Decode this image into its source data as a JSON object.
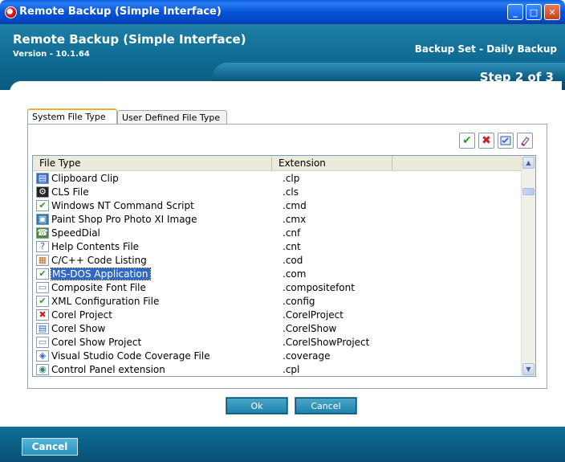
{
  "window": {
    "title": "Remote Backup (Simple Interface)",
    "controls": {
      "minimize": "_",
      "maximize": "□",
      "close": "✕"
    }
  },
  "header": {
    "app_name": "Remote Backup (Simple Interface)",
    "version": "Version - 10.1.64",
    "backup_set": "Backup Set - Daily Backup",
    "step": "Step 2 of 3"
  },
  "tabs": [
    {
      "label": "System File Type",
      "active": true
    },
    {
      "label": "User Defined File Type",
      "active": false
    }
  ],
  "toolbar": {
    "select_all_icon": "✔",
    "deselect_all_icon": "✖",
    "select_icon": "select-icon",
    "clear_icon": "eraser-icon"
  },
  "list": {
    "columns": [
      "File Type",
      "Extension"
    ],
    "rows": [
      {
        "file_type": "Clipboard Clip",
        "extension": ".clp",
        "icon": "clipboard-icon"
      },
      {
        "file_type": "CLS File",
        "extension": ".cls",
        "icon": "gear-icon"
      },
      {
        "file_type": "Windows NT Command Script",
        "extension": ".cmd",
        "icon": "check-icon"
      },
      {
        "file_type": "Paint Shop Pro Photo XI Image",
        "extension": ".cmx",
        "icon": "image-icon"
      },
      {
        "file_type": "SpeedDial",
        "extension": ".cnf",
        "icon": "speeddial-icon"
      },
      {
        "file_type": "Help Contents File",
        "extension": ".cnt",
        "icon": "help-icon"
      },
      {
        "file_type": "C/C++ Code Listing",
        "extension": ".cod",
        "icon": "code-icon"
      },
      {
        "file_type": "MS-DOS Application",
        "extension": ".com",
        "icon": "check-icon",
        "selected": true
      },
      {
        "file_type": "Composite Font File",
        "extension": ".compositefont",
        "icon": "file-icon"
      },
      {
        "file_type": "XML Configuration File",
        "extension": ".config",
        "icon": "xml-icon"
      },
      {
        "file_type": "Corel Project",
        "extension": ".CorelProject",
        "icon": "x-icon"
      },
      {
        "file_type": "Corel Show",
        "extension": ".CorelShow",
        "icon": "document-icon"
      },
      {
        "file_type": "Corel Show Project",
        "extension": ".CorelShowProject",
        "icon": "file-icon"
      },
      {
        "file_type": "Visual Studio Code Coverage File",
        "extension": ".coverage",
        "icon": "coverage-icon"
      },
      {
        "file_type": "Control Panel extension",
        "extension": ".cpl",
        "icon": "control-panel-icon"
      }
    ]
  },
  "buttons": {
    "ok": "Ok",
    "cancel_dialog": "Cancel",
    "cancel_footer": "Cancel"
  },
  "colors": {
    "header_teal": "#0e6a92",
    "selection": "#316ac5",
    "titlebar_blue": "#0553d8"
  }
}
